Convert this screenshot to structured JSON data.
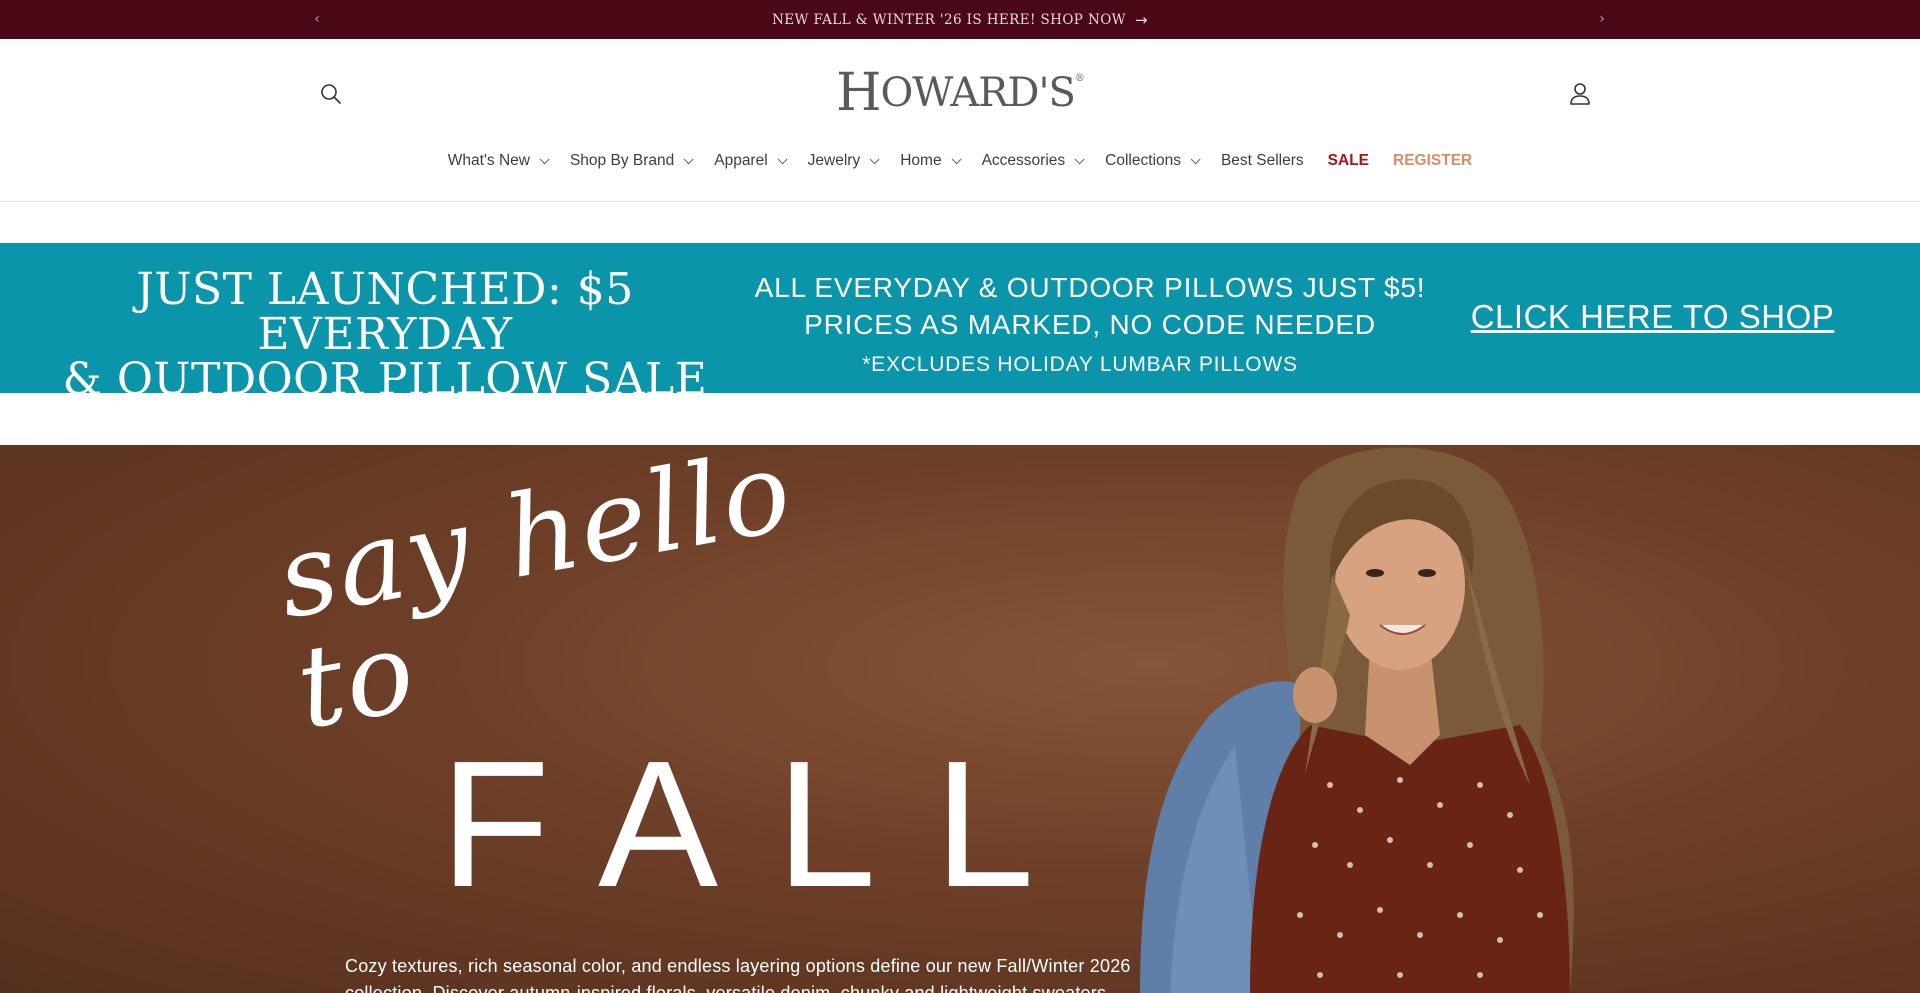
{
  "announcement": {
    "message": "NEW FALL & WINTER '26 IS HERE! SHOP NOW",
    "arrow": "→",
    "prev": "‹",
    "next": "›"
  },
  "header": {
    "logo_text": "HOWARDS",
    "logo_first": "H",
    "logo_rest": "OWARD",
    "logo_apostrophe": "'",
    "logo_last": "S",
    "logo_reg": "®",
    "search_icon": "search-icon",
    "account_icon": "account-icon"
  },
  "nav": {
    "items": [
      {
        "label": "What's New",
        "dropdown": true
      },
      {
        "label": "Shop By Brand",
        "dropdown": true
      },
      {
        "label": "Apparel",
        "dropdown": true
      },
      {
        "label": "Jewelry",
        "dropdown": true
      },
      {
        "label": "Home",
        "dropdown": true
      },
      {
        "label": "Accessories",
        "dropdown": true
      },
      {
        "label": "Collections",
        "dropdown": true
      },
      {
        "label": "Best Sellers",
        "dropdown": false
      },
      {
        "label": "SALE",
        "dropdown": false
      },
      {
        "label": "REGISTER",
        "dropdown": false
      }
    ]
  },
  "promo": {
    "headline_line1": "JUST LAUNCHED: $5 EVERYDAY",
    "headline_line2": "& OUTDOOR PILLOW SALE",
    "mid_line1": "ALL EVERYDAY & OUTDOOR PILLOWS JUST $5!",
    "mid_line2": "PRICES AS MARKED, NO CODE NEEDED",
    "note": "*EXCLUDES HOLIDAY LUMBAR PILLOWS",
    "cta": "CLICK HERE TO SHOP",
    "background": "#0b95ab"
  },
  "hero": {
    "script": "say hello to",
    "title": "FALL",
    "body": "Cozy textures, rich seasonal color, and endless layering options define our new Fall/Winter 2026 collection. Discover autumn-inspired florals, versatile denim, chunky and lightweight sweaters"
  },
  "colors": {
    "announcement_bg": "#4a0716",
    "sale": "#a8141c",
    "register": "#d98c6c",
    "hero_bg": "#6e3f28"
  }
}
